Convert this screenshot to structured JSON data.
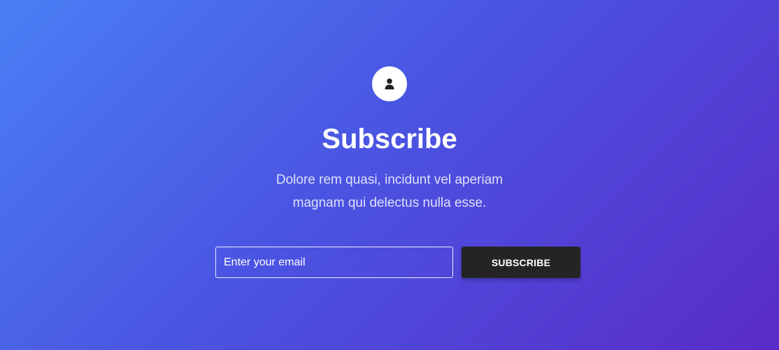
{
  "header": {
    "icon": "user-icon"
  },
  "title": "Subscribe",
  "description": "Dolore rem quasi, incidunt vel aperiam magnam qui delectus nulla esse.",
  "form": {
    "email_placeholder": "Enter your email",
    "email_value": "",
    "button_label": "SUBSCRIBE"
  },
  "colors": {
    "gradient_start": "#4a7ff5",
    "gradient_end": "#5a2bc8",
    "button_bg": "#242424",
    "text": "#ffffff"
  }
}
